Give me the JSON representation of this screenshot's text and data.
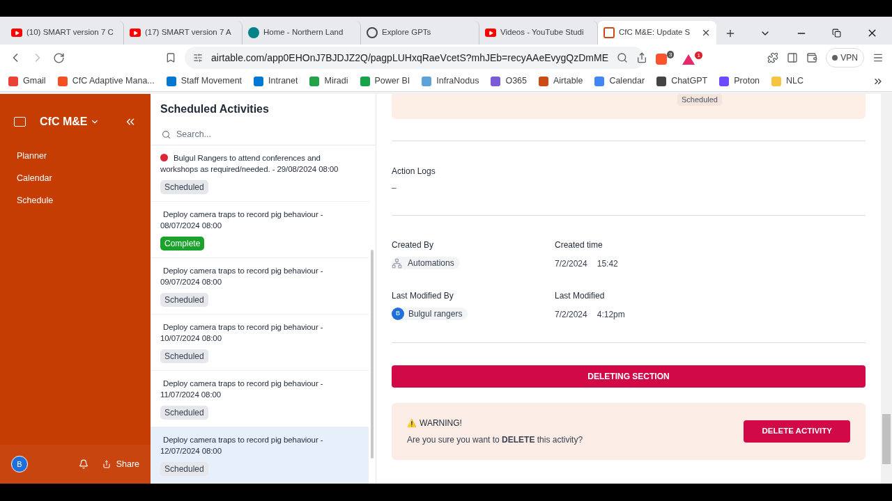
{
  "browser": {
    "tabs": [
      {
        "title": "(10) SMART version 7 C",
        "kind": "youtube",
        "selected": false
      },
      {
        "title": "(17) SMART version 7 A",
        "kind": "youtube",
        "selected": false
      },
      {
        "title": "Home - Northern Land",
        "kind": "sharepoint",
        "selected": false
      },
      {
        "title": "Explore GPTs",
        "kind": "openai",
        "selected": false
      },
      {
        "title": "Videos - YouTube Studi",
        "kind": "youtube",
        "selected": false
      },
      {
        "title": "CfC M&E: Update S",
        "kind": "app",
        "selected": true
      }
    ],
    "url": "airtable.com/app0EHOnJ7BJDJZ2Q/pagpLUHxqRaeVcetS?mhJEb=recyAAeEvygQzDmME",
    "shield_count": "3",
    "alert_count": "1",
    "vpn_label": "VPN",
    "bookmarks": [
      {
        "label": "Gmail",
        "color": "#ea4335"
      },
      {
        "label": "CfC Adaptive Mana...",
        "color": "#f25022"
      },
      {
        "label": "Staff Movement",
        "color": "#0078d4"
      },
      {
        "label": "Intranet",
        "color": "#0078d4"
      },
      {
        "label": "Miradi",
        "color": "#22a34a"
      },
      {
        "label": "Power BI",
        "color": "#16a34a"
      },
      {
        "label": "InfraNodus",
        "color": "#5ba3d9"
      },
      {
        "label": "O365",
        "color": "#7c5cd6"
      },
      {
        "label": "Airtable",
        "color": "#cc4a13"
      },
      {
        "label": "Calendar",
        "color": "#4285f4"
      },
      {
        "label": "ChatGPT",
        "color": "#444444"
      },
      {
        "label": "Proton",
        "color": "#6d4aff"
      },
      {
        "label": "NLC",
        "color": "#f5c542"
      }
    ]
  },
  "sidebar": {
    "app_name": "CfC M&E",
    "items": [
      {
        "label": "Planner"
      },
      {
        "label": "Calendar"
      },
      {
        "label": "Schedule"
      }
    ],
    "avatar": "B",
    "share_label": "Share"
  },
  "list": {
    "title": "Scheduled Activities",
    "search": {
      "placeholder": "Search..."
    },
    "items": [
      {
        "title": "Bulgul Rangers to attend conferences and workshops as required/needed. - 29/08/2024 08:00",
        "flagged": true,
        "status": "Scheduled",
        "kind": "scheduled",
        "selected": false
      },
      {
        "title": "Deploy camera traps to record pig behaviour - 08/07/2024 08:00",
        "flagged": false,
        "status": "Complete",
        "kind": "complete",
        "selected": false
      },
      {
        "title": "Deploy camera traps to record pig behaviour - 09/07/2024 08:00",
        "flagged": false,
        "status": "Scheduled",
        "kind": "scheduled",
        "selected": false
      },
      {
        "title": "Deploy camera traps to record pig behaviour - 10/07/2024 08:00",
        "flagged": false,
        "status": "Scheduled",
        "kind": "scheduled",
        "selected": false
      },
      {
        "title": "Deploy camera traps to record pig behaviour - 11/07/2024 08:00",
        "flagged": false,
        "status": "Scheduled",
        "kind": "scheduled",
        "selected": false
      },
      {
        "title": "Deploy camera traps to record pig behaviour - 12/07/2024 08:00",
        "flagged": false,
        "status": "Scheduled",
        "kind": "scheduled",
        "selected": true
      }
    ]
  },
  "detail": {
    "top_status": "Scheduled",
    "action_logs": {
      "label": "Action Logs",
      "value": "–"
    },
    "created_by": {
      "label": "Created By",
      "value": "Automations"
    },
    "created_time": {
      "label": "Created time",
      "date": "7/2/2024",
      "time": "15:42"
    },
    "modified_by": {
      "label": "Last Modified By",
      "avatar": "B",
      "value": "Bulgul rangers"
    },
    "modified": {
      "label": "Last Modified",
      "date": "7/2/2024",
      "time": "4:12pm"
    },
    "section_bar": "DELETING SECTION",
    "warning": {
      "icon": "⚠️",
      "title": "WARNING!",
      "message": "Are you sure you want to **DELETE** this activity?",
      "button": "DELETE ACTIVITY"
    }
  }
}
